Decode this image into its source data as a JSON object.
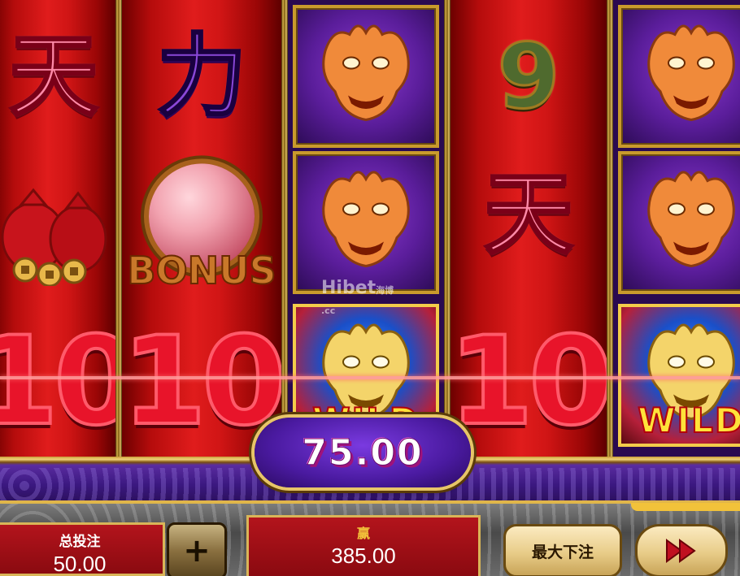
{
  "reels": [
    {
      "symbols": [
        "天",
        "bonus-coins-bags",
        "10"
      ],
      "styles": [
        "pink",
        "bags",
        "ten"
      ]
    },
    {
      "symbols": [
        "力",
        "bonus-orb",
        "10"
      ],
      "styles": [
        "purple",
        "bonus",
        "ten"
      ]
    },
    {
      "symbols": [
        "dragon",
        "dragon",
        "wild-dragon"
      ],
      "styles": [
        "dragon",
        "dragon",
        "wild"
      ]
    },
    {
      "symbols": [
        "9",
        "天",
        "10"
      ],
      "styles": [
        "green",
        "pink",
        "ten"
      ]
    },
    {
      "symbols": [
        "dragon",
        "dragon",
        "wild-dragon"
      ],
      "styles": [
        "dragon",
        "dragon",
        "wild"
      ]
    }
  ],
  "labels": {
    "bonus": "BONUS",
    "wild_partial": "WILD",
    "wild_partial_right": "WILD",
    "ten": "10",
    "glyph_tian": "天",
    "glyph_li": "力",
    "glyph_nine": "9"
  },
  "watermark": {
    "text": "Hibet",
    "sub": "海博",
    "sub2": ".cc"
  },
  "win_amount": "75.00",
  "footer": {
    "total_bet_label": "总投注",
    "total_bet_value": "50.00",
    "win_label": "赢",
    "win_value": "385.00",
    "max_bet_label": "最大下注",
    "plus_label": "+"
  },
  "icons": {
    "plus": "plus-icon",
    "fast_forward": "fast-forward-icon"
  },
  "colors": {
    "reel_red": "#e01c1c",
    "gold": "#e7c568",
    "purple": "#5a1d9a",
    "win_text": "#ffffff"
  }
}
